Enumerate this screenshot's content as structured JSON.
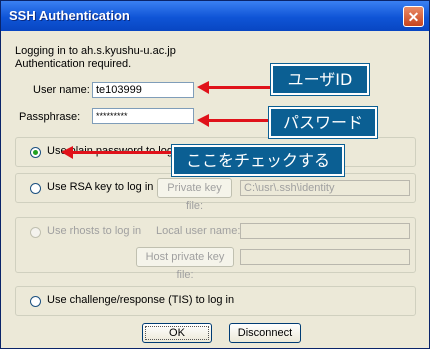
{
  "window": {
    "title": "SSH Authentication",
    "close_glyph": "✕"
  },
  "info": {
    "line1": "Logging in to ah.s.kyushu-u.ac.jp",
    "line2": "Authentication required."
  },
  "fields": {
    "user_name_label": "User name:",
    "user_name_value": "te103999",
    "passphrase_label": "Passphrase:",
    "passphrase_value": "*********"
  },
  "options": {
    "plain_password": "Use plain password to log in",
    "rsa_key": "Use RSA key to log in",
    "private_key_button": "Private key file:",
    "private_key_path": "C:\\usr\\.ssh\\identity",
    "rhosts": "Use rhosts to log in",
    "local_user_label": "Local user name:",
    "host_key_button": "Host private key file:",
    "challenge": "Use challenge/response (TIS) to log in",
    "selected": "plain_password"
  },
  "buttons": {
    "ok": "OK",
    "disconnect": "Disconnect"
  },
  "annotations": {
    "user_id": "ユーザID",
    "password": "パスワード",
    "check_here": "ここをチェックする"
  },
  "colors": {
    "titlebar": "#0f54d6",
    "callout_bg": "#0b5f93",
    "arrow": "#e0121a"
  }
}
